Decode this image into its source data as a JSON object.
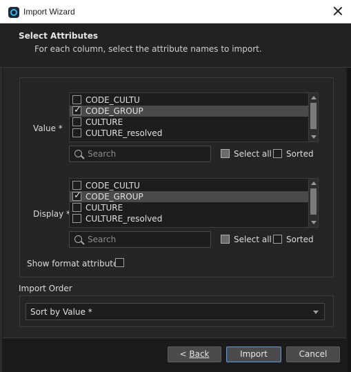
{
  "window": {
    "title": "Import Wizard"
  },
  "header": {
    "title": "Select Attributes",
    "subtitle": "For each column, select the attribute names to import."
  },
  "value_section": {
    "label": "Value *",
    "items": [
      {
        "label": "CODE_CULTU",
        "checked": false,
        "selected": false
      },
      {
        "label": "CODE_GROUP",
        "checked": true,
        "selected": true
      },
      {
        "label": "CULTURE",
        "checked": false,
        "selected": false
      },
      {
        "label": "CULTURE_resolved",
        "checked": false,
        "selected": false
      }
    ],
    "search_placeholder": "Search",
    "select_all_label": "Select all",
    "sorted_label": "Sorted"
  },
  "display_section": {
    "label": "Display *",
    "items": [
      {
        "label": "CODE_CULTU",
        "checked": false,
        "selected": false
      },
      {
        "label": "CODE_GROUP",
        "checked": true,
        "selected": true
      },
      {
        "label": "CULTURE",
        "checked": false,
        "selected": false
      },
      {
        "label": "CULTURE_resolved",
        "checked": false,
        "selected": false
      }
    ],
    "search_placeholder": "Search",
    "select_all_label": "Select all",
    "sorted_label": "Sorted"
  },
  "show_format_label": "Show format attributes",
  "import_order": {
    "label": "Import Order",
    "selected": "Sort by Value *"
  },
  "buttons": {
    "back_prefix": "< ",
    "back_label": "Back",
    "import_label": "Import",
    "cancel_label": "Cancel"
  }
}
